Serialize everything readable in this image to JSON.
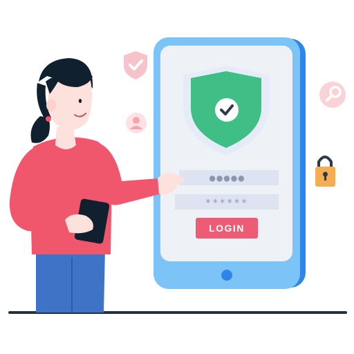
{
  "login_form": {
    "username_masked": "●●●●●",
    "password_masked": "******",
    "login_label": "LOGIN"
  },
  "colors": {
    "phone_blue": "#2f86e8",
    "phone_light": "#7cc4f8",
    "screen_bg": "#eef2f7",
    "shield_green": "#3fbf85",
    "login_button": "#ee5b74",
    "shirt": "#f1576c",
    "pants": "#3f73c6",
    "padlock": "#f2ad55",
    "accent_pink": "#f6c3cb"
  },
  "icons": {
    "shield": "shield-check-icon",
    "user": "user-icon",
    "search": "search-icon",
    "padlock": "padlock-icon",
    "small_shield": "shield-check-small-icon"
  }
}
